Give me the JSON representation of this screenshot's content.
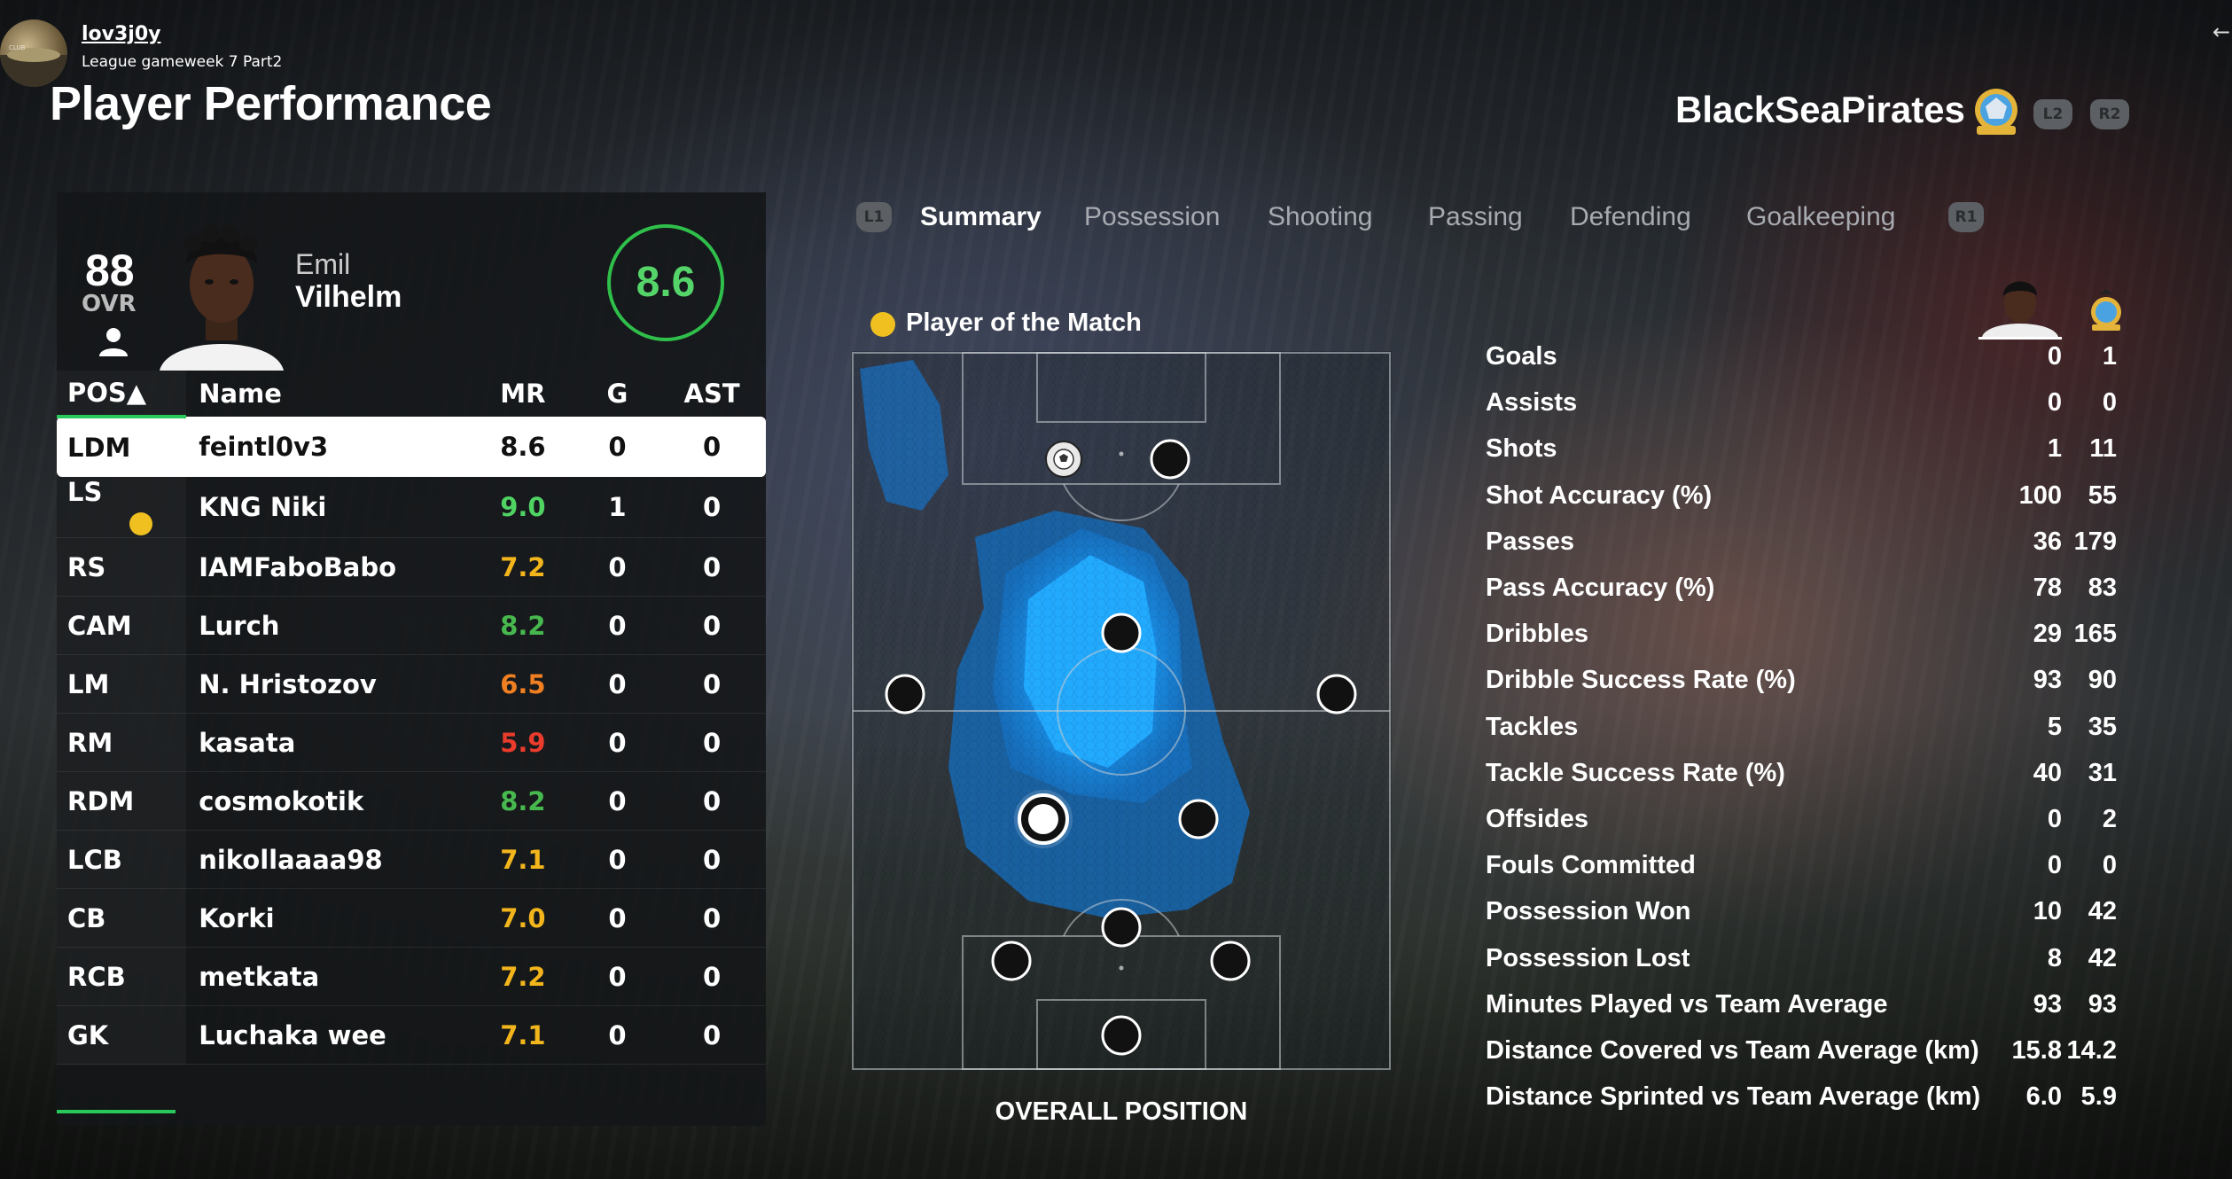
{
  "header": {
    "username": "lov3j0y",
    "subtitle": "League gameweek 7 Part2",
    "page_title": "Player Performance",
    "back_icon": "arrow-left-icon"
  },
  "team": {
    "name": "BlackSeaPirates",
    "crest_icon": "team-crest-icon",
    "l2_label": "L2",
    "r2_label": "R2"
  },
  "player_card": {
    "ovr": "88",
    "ovr_label": "OVR",
    "first_name": "Emil",
    "last_name": "Vilhelm",
    "match_rating": "8.6",
    "ring_color": "#2fbf4a"
  },
  "roster": {
    "headers": {
      "pos": "POS▲",
      "name": "Name",
      "mr": "MR",
      "g": "G",
      "ast": "AST"
    },
    "rows": [
      {
        "pos": "LDM",
        "name": "feintl0v3",
        "mr": "8.6",
        "g": "0",
        "ast": "0",
        "mr_color": "#111111",
        "potm": false
      },
      {
        "pos": "LS",
        "name": "KNG Niki",
        "mr": "9.0",
        "g": "1",
        "ast": "0",
        "mr_color": "#4fd463",
        "potm": true
      },
      {
        "pos": "RS",
        "name": "IAMFaboBabo",
        "mr": "7.2",
        "g": "0",
        "ast": "0",
        "mr_color": "#f2b51c",
        "potm": false
      },
      {
        "pos": "CAM",
        "name": "Lurch",
        "mr": "8.2",
        "g": "0",
        "ast": "0",
        "mr_color": "#47b84e",
        "potm": false
      },
      {
        "pos": "LM",
        "name": "N. Hristozov",
        "mr": "6.5",
        "g": "0",
        "ast": "0",
        "mr_color": "#f07f22",
        "potm": false
      },
      {
        "pos": "RM",
        "name": "kasata",
        "mr": "5.9",
        "g": "0",
        "ast": "0",
        "mr_color": "#ea3b2c",
        "potm": false
      },
      {
        "pos": "RDM",
        "name": "cosmokotik",
        "mr": "8.2",
        "g": "0",
        "ast": "0",
        "mr_color": "#47b84e",
        "potm": false
      },
      {
        "pos": "LCB",
        "name": "nikollaaaa98",
        "mr": "7.1",
        "g": "0",
        "ast": "0",
        "mr_color": "#f2b51c",
        "potm": false
      },
      {
        "pos": "CB",
        "name": "Korki",
        "mr": "7.0",
        "g": "0",
        "ast": "0",
        "mr_color": "#f2b51c",
        "potm": false
      },
      {
        "pos": "RCB",
        "name": "metkata",
        "mr": "7.2",
        "g": "0",
        "ast": "0",
        "mr_color": "#f2b51c",
        "potm": false
      },
      {
        "pos": "GK",
        "name": "Luchaka wee",
        "mr": "7.1",
        "g": "0",
        "ast": "0",
        "mr_color": "#f2b51c",
        "potm": false
      }
    ]
  },
  "tabs": {
    "l1": "L1",
    "r1": "R1",
    "items": [
      "Summary",
      "Possession",
      "Shooting",
      "Passing",
      "Defending",
      "Goalkeeping"
    ],
    "active": "Summary"
  },
  "pitch": {
    "potm_label": "Player of the Match",
    "caption": "OVERALL POSITION",
    "heat_color": "#1e9bf0"
  },
  "stats": [
    {
      "label": "Goals",
      "player": "0",
      "team": "1"
    },
    {
      "label": "Assists",
      "player": "0",
      "team": "0"
    },
    {
      "label": "Shots",
      "player": "1",
      "team": "11"
    },
    {
      "label": "Shot Accuracy (%)",
      "player": "100",
      "team": "55"
    },
    {
      "label": "Passes",
      "player": "36",
      "team": "179"
    },
    {
      "label": "Pass Accuracy (%)",
      "player": "78",
      "team": "83"
    },
    {
      "label": "Dribbles",
      "player": "29",
      "team": "165"
    },
    {
      "label": "Dribble Success Rate (%)",
      "player": "93",
      "team": "90"
    },
    {
      "label": "Tackles",
      "player": "5",
      "team": "35"
    },
    {
      "label": "Tackle Success Rate (%)",
      "player": "40",
      "team": "31"
    },
    {
      "label": "Offsides",
      "player": "0",
      "team": "2"
    },
    {
      "label": "Fouls Committed",
      "player": "0",
      "team": "0"
    },
    {
      "label": "Possession Won",
      "player": "10",
      "team": "42"
    },
    {
      "label": "Possession Lost",
      "player": "8",
      "team": "42"
    },
    {
      "label": "Minutes Played vs Team Average",
      "player": "93",
      "team": "93"
    },
    {
      "label": "Distance Covered vs Team Average (km)",
      "player": "15.8",
      "team": "14.2"
    },
    {
      "label": "Distance Sprinted vs Team Average (km)",
      "player": "6.0",
      "team": "5.9"
    }
  ]
}
